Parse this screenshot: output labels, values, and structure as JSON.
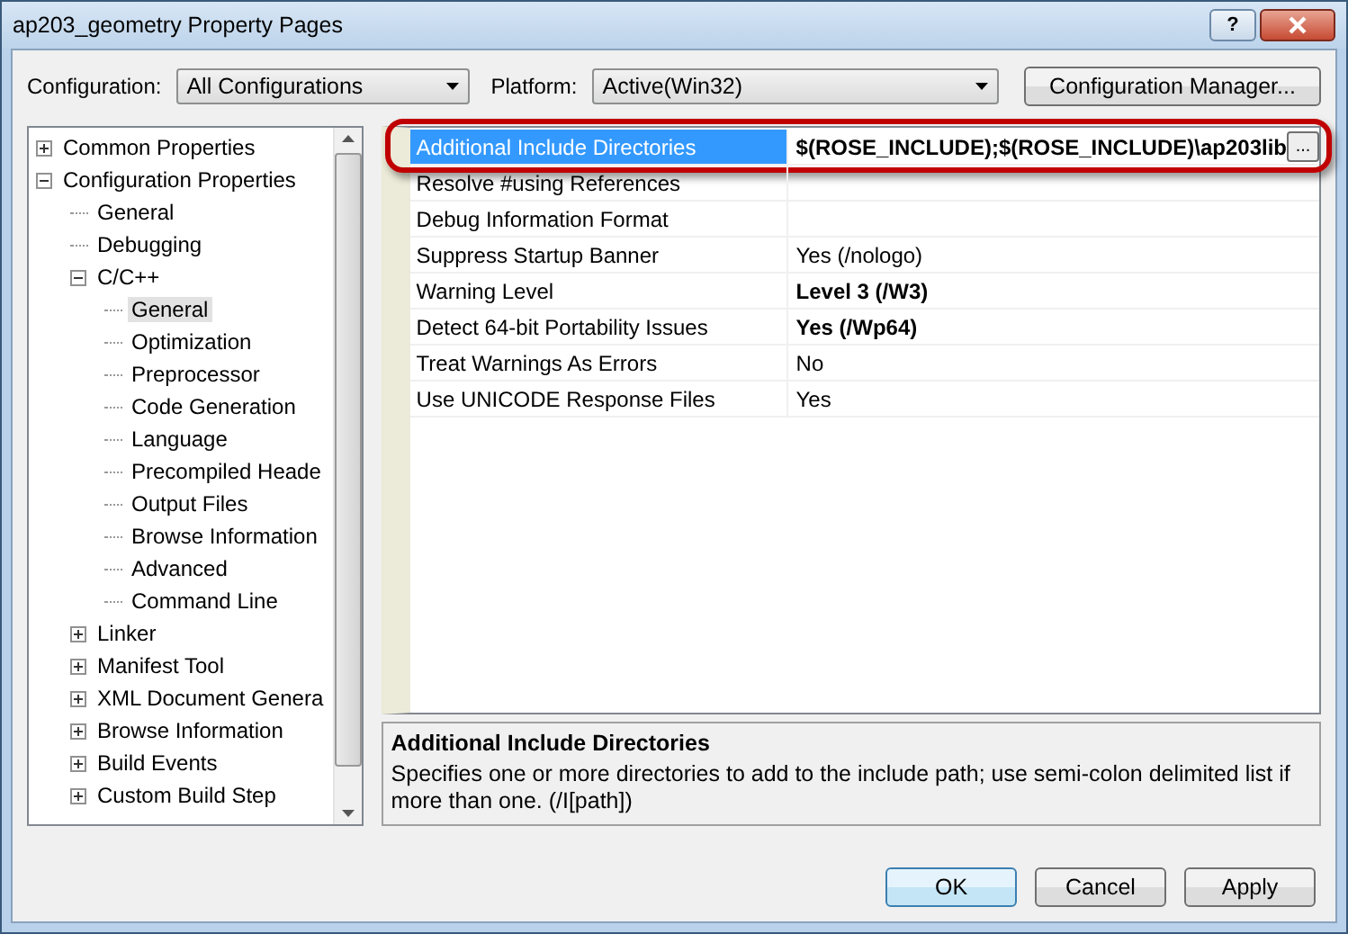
{
  "window": {
    "title": "ap203_geometry Property Pages",
    "help_button": "?"
  },
  "configuration": {
    "label": "Configuration:",
    "value": "All Configurations"
  },
  "platform": {
    "label": "Platform:",
    "value": "Active(Win32)"
  },
  "config_manager_button": "Configuration Manager...",
  "tree": [
    {
      "label": "Common Properties",
      "expanded": false,
      "selected": false
    },
    {
      "label": "Configuration Properties",
      "expanded": true,
      "selected": false,
      "children": [
        {
          "label": "General",
          "selected": false
        },
        {
          "label": "Debugging",
          "selected": false
        },
        {
          "label": "C/C++",
          "expanded": true,
          "selected": false,
          "children": [
            {
              "label": "General",
              "selected": true
            },
            {
              "label": "Optimization",
              "selected": false
            },
            {
              "label": "Preprocessor",
              "selected": false
            },
            {
              "label": "Code Generation",
              "selected": false
            },
            {
              "label": "Language",
              "selected": false
            },
            {
              "label": "Precompiled Heade",
              "selected": false
            },
            {
              "label": "Output Files",
              "selected": false
            },
            {
              "label": "Browse Information",
              "selected": false
            },
            {
              "label": "Advanced",
              "selected": false
            },
            {
              "label": "Command Line",
              "selected": false
            }
          ]
        },
        {
          "label": "Linker",
          "expanded": false,
          "selected": false
        },
        {
          "label": "Manifest Tool",
          "expanded": false,
          "selected": false
        },
        {
          "label": "XML Document Genera",
          "expanded": false,
          "selected": false
        },
        {
          "label": "Browse Information",
          "expanded": false,
          "selected": false
        },
        {
          "label": "Build Events",
          "expanded": false,
          "selected": false
        },
        {
          "label": "Custom Build Step",
          "expanded": false,
          "selected": false
        }
      ]
    }
  ],
  "properties": [
    {
      "name": "Additional Include Directories",
      "value": "$(ROSE_INCLUDE);$(ROSE_INCLUDE)\\ap203lib",
      "bold": true,
      "selected": true,
      "highlighted": true
    },
    {
      "name": "Resolve #using References",
      "selected": false,
      "highlighted": false
    },
    {
      "name": "Debug Information Format",
      "selected": false,
      "highlighted": false
    },
    {
      "name": "Suppress Startup Banner",
      "value": "Yes (/nologo)",
      "bold": false,
      "selected": false,
      "highlighted": false
    },
    {
      "name": "Warning Level",
      "value": "Level 3 (/W3)",
      "bold": true,
      "selected": false,
      "highlighted": false
    },
    {
      "name": "Detect 64-bit Portability Issues",
      "value": "Yes (/Wp64)",
      "bold": true,
      "selected": false,
      "highlighted": false
    },
    {
      "name": "Treat Warnings As Errors",
      "value": "No",
      "bold": false,
      "selected": false,
      "highlighted": false
    },
    {
      "name": "Use UNICODE Response Files",
      "value": "Yes",
      "bold": false,
      "selected": false,
      "highlighted": false
    }
  ],
  "browse_button": "...",
  "description": {
    "title": "Additional Include Directories",
    "text": "Specifies one or more directories to add to the include path; use semi-colon delimited list if more than one.     (/I[path])"
  },
  "buttons": [
    {
      "label": "OK",
      "default": true
    },
    {
      "label": "Cancel",
      "default": false
    },
    {
      "label": "Apply",
      "default": false
    }
  ]
}
